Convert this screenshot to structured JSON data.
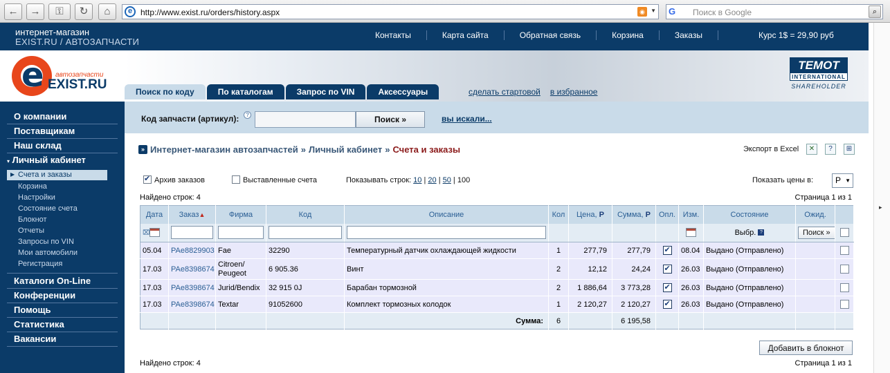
{
  "browser": {
    "url": "http://www.exist.ru/orders/history.aspx",
    "search_placeholder": "Поиск в Google",
    "search_engine": "G"
  },
  "site": {
    "title_line1": "интернет-магазин",
    "title_line2": "EXIST.RU / АВТОЗАПЧАСТИ",
    "nav": [
      "Контакты",
      "Карта сайта",
      "Обратная связь",
      "Корзина",
      "Заказы"
    ],
    "rate": "Курс 1$ = 29,90 руб",
    "logo_sub": "автозапчасти",
    "logo_brand": "EXIST.RU",
    "logo_letter": "e",
    "partner_line1": "TEMOT",
    "partner_line2": "INTERNATIONAL",
    "partner_line3": "SHAREHOLDER"
  },
  "tabs": [
    "Поиск по коду",
    "По каталогам",
    "Запрос по VIN",
    "Аксессуары"
  ],
  "tab_links": [
    "сделать стартовой",
    "в избранное"
  ],
  "sidebar": {
    "main_top": [
      "О компании",
      "Поставщикам",
      "Наш склад",
      "Личный кабинет"
    ],
    "sub": [
      "Счета и заказы",
      "Корзина",
      "Настройки",
      "Состояние счета",
      "Блокнот",
      "Отчеты",
      "Запросы по VIN",
      "Мои автомобили",
      "Регистрация"
    ],
    "main_bottom": [
      "Каталоги On-Line",
      "Конференции",
      "Помощь",
      "Статистика",
      "Вакансии"
    ]
  },
  "search": {
    "label": "Код запчасти (артикул):",
    "help": "?",
    "value": "",
    "button": "Поиск »",
    "history_link": "вы искали..."
  },
  "breadcrumb": {
    "items": [
      "Интернет-магазин автозапчастей",
      "Личный кабинет"
    ],
    "current": "Счета и заказы",
    "separator": "»"
  },
  "export_label": "Экспорт в Excel",
  "filters": {
    "archive_label": "Архив заказов",
    "archive_checked": true,
    "invoices_label": "Выставленные счета",
    "invoices_checked": false,
    "rows_label": "Показывать строк:",
    "rows_options": [
      "10",
      "20",
      "50"
    ],
    "rows_current": "100",
    "price_label": "Показать цены в:",
    "price_currency": "Р"
  },
  "found_text": "Найдено строк: 4",
  "page_text": "Страница 1 из 1",
  "table": {
    "headers": [
      "Дата",
      "Заказ",
      "Фирма",
      "Код",
      "Описание",
      "Кол",
      "Цена, ",
      "Сумма, ",
      "Опл.",
      "Изм.",
      "Состояние",
      "Ожид."
    ],
    "currency_sign": "Р",
    "sort_marker": "▲",
    "filter_select_label": "Выбр.",
    "filter_search_button": "Поиск »",
    "rows": [
      {
        "date": "05.04",
        "order": "PAe8829903",
        "firm": "Fae",
        "code": "32290",
        "desc": "Температурный датчик охлаждающей жидкости",
        "qty": "1",
        "price": "277,79",
        "sum": "277,79",
        "paid": true,
        "changed": "08.04",
        "status": "Выдано (Отправлено)"
      },
      {
        "date": "17.03",
        "order": "PAe8398674",
        "firm": "Citroen/ Peugeot",
        "code": "6 905.36",
        "desc": "Винт",
        "qty": "2",
        "price": "12,12",
        "sum": "24,24",
        "paid": true,
        "changed": "26.03",
        "status": "Выдано (Отправлено)"
      },
      {
        "date": "17.03",
        "order": "PAe8398674",
        "firm": "Jurid/Bendix",
        "code": "32 915 0J",
        "desc": "Барабан тормозной",
        "qty": "2",
        "price": "1 886,64",
        "sum": "3 773,28",
        "paid": true,
        "changed": "26.03",
        "status": "Выдано (Отправлено)"
      },
      {
        "date": "17.03",
        "order": "PAe8398674",
        "firm": "Textar",
        "code": "91052600",
        "desc": "Комплект тормозных колодок",
        "qty": "1",
        "price": "2 120,27",
        "sum": "2 120,27",
        "paid": true,
        "changed": "26.03",
        "status": "Выдано (Отправлено)"
      }
    ],
    "total_label": "Сумма:",
    "total_qty": "6",
    "total_sum": "6 195,58"
  },
  "add_notebook_button": "Добавить в блокнот"
}
